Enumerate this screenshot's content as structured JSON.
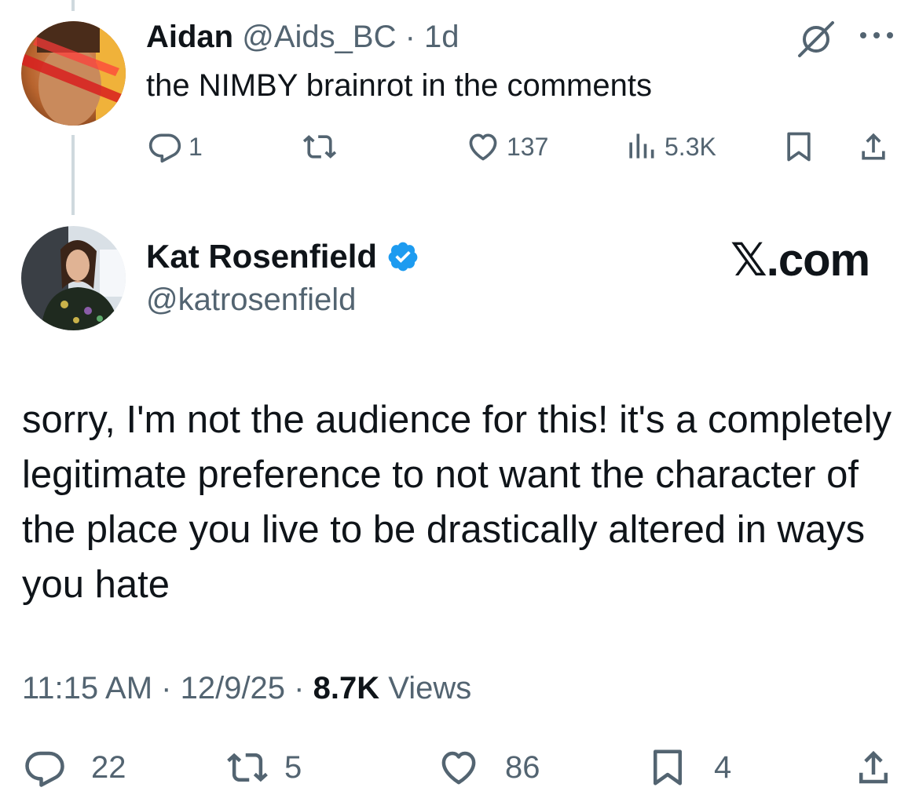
{
  "reply": {
    "name": "Aidan",
    "handle": "@Aids_BC",
    "separator": " · ",
    "time": "1d",
    "text": "the NIMBY brainrot in the comments",
    "actions": {
      "replies": "1",
      "reposts": "",
      "likes": "137",
      "views": "5.3K"
    }
  },
  "main_tweet": {
    "name": "Kat Rosenfield",
    "handle": "@katrosenfield",
    "brand": "𝕏.com",
    "text": "sorry, I'm not the audience for this! it's a completely legitimate preference to not want the character of the place you live to be drastically altered in ways you hate",
    "time": "11:15 AM",
    "date": "12/9/25",
    "views_count": "8.7K",
    "views_label": "Views",
    "sep": " · ",
    "actions": {
      "replies": "22",
      "reposts": "5",
      "likes": "86",
      "bookmarks": "4"
    }
  },
  "colors": {
    "text": "#0f1419",
    "muted": "#536471",
    "verified": "#1d9bf0",
    "thread_line": "#cfd9de"
  }
}
